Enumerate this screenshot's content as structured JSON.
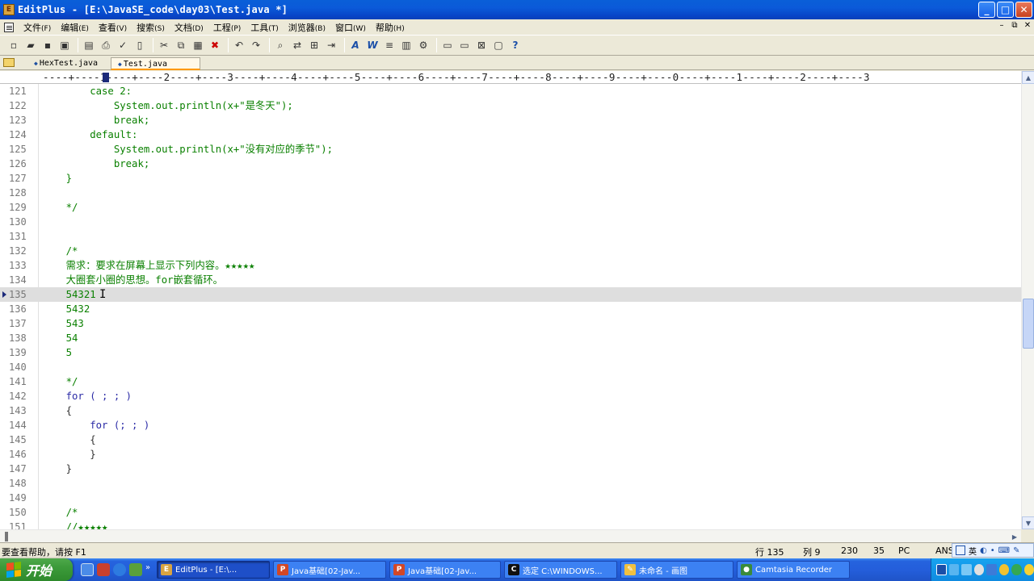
{
  "window": {
    "title": "EditPlus - [E:\\JavaSE_code\\day03\\Test.java *]",
    "minimize": "_",
    "maximize": "□",
    "close": "✕"
  },
  "menu": [
    {
      "label": "文件",
      "acc": "(F)"
    },
    {
      "label": "编辑",
      "acc": "(E)"
    },
    {
      "label": "查看",
      "acc": "(V)"
    },
    {
      "label": "搜索",
      "acc": "(S)"
    },
    {
      "label": "文档",
      "acc": "(D)"
    },
    {
      "label": "工程",
      "acc": "(P)"
    },
    {
      "label": "工具",
      "acc": "(T)"
    },
    {
      "label": "浏览器",
      "acc": "(B)"
    },
    {
      "label": "窗口",
      "acc": "(W)"
    },
    {
      "label": "帮助",
      "acc": "(H)"
    }
  ],
  "mdi_buttons": [
    "–",
    "⧉",
    "✕"
  ],
  "toolbar_icons": [
    "new-file-icon",
    "open-folder-icon",
    "save-icon",
    "save-all-icon",
    "sep",
    "print-preview-icon",
    "print-icon",
    "spell-check-icon",
    "page-icon",
    "sep",
    "cut-icon",
    "copy-icon",
    "paste-icon",
    "delete-icon",
    "sep",
    "undo-icon",
    "redo-icon",
    "sep",
    "find-icon",
    "replace-icon",
    "find-files-icon",
    "goto-icon",
    "sep",
    "font-icon",
    "word-wrap-icon",
    "indent-icon",
    "column-icon",
    "settings-icon",
    "sep",
    "window-icon",
    "window2-icon",
    "close-window-icon",
    "browser-icon",
    "help-icon"
  ],
  "tabs": [
    {
      "label": "HexTest.java",
      "active": false
    },
    {
      "label": "Test.java",
      "active": true
    }
  ],
  "ruler": "----+----1----+----2----+----3----+----4----+----5----+----6----+----7----+----8----+----9----+----0----+----1----+----2----+----3",
  "editor": {
    "lines": [
      {
        "n": "121",
        "text": "        case 2:",
        "style": "comment"
      },
      {
        "n": "122",
        "text": "            System.out.println(x+\"是冬天\");",
        "style": "comment"
      },
      {
        "n": "123",
        "text": "            break;",
        "style": "comment"
      },
      {
        "n": "124",
        "text": "        default:",
        "style": "comment"
      },
      {
        "n": "125",
        "text": "            System.out.println(x+\"没有对应的季节\");",
        "style": "comment"
      },
      {
        "n": "126",
        "text": "            break;",
        "style": "comment"
      },
      {
        "n": "127",
        "text": "    }",
        "style": "comment"
      },
      {
        "n": "128",
        "text": "",
        "style": "comment"
      },
      {
        "n": "129",
        "text": "    */",
        "style": "comment"
      },
      {
        "n": "130",
        "text": "",
        "style": "comment"
      },
      {
        "n": "131",
        "text": "",
        "style": "comment"
      },
      {
        "n": "132",
        "text": "    /*",
        "style": "comment"
      },
      {
        "n": "133",
        "text": "    需求：要求在屏幕上显示下列内容。★★★★★",
        "style": "comment"
      },
      {
        "n": "134",
        "text": "    大圈套小圈的思想。for嵌套循环。",
        "style": "comment"
      },
      {
        "n": "135",
        "text": "    54321",
        "style": "comment",
        "current": true
      },
      {
        "n": "136",
        "text": "    5432",
        "style": "comment"
      },
      {
        "n": "137",
        "text": "    543",
        "style": "comment"
      },
      {
        "n": "138",
        "text": "    54",
        "style": "comment"
      },
      {
        "n": "139",
        "text": "    5",
        "style": "comment"
      },
      {
        "n": "140",
        "text": "",
        "style": "comment"
      },
      {
        "n": "141",
        "text": "    */",
        "style": "comment"
      },
      {
        "n": "142",
        "text": "    for ( ; ; )",
        "style": "kw"
      },
      {
        "n": "143",
        "text": "    {",
        "style": "default"
      },
      {
        "n": "144",
        "text": "        for (; ; )",
        "style": "kw"
      },
      {
        "n": "145",
        "text": "        {",
        "style": "default"
      },
      {
        "n": "146",
        "text": "        }",
        "style": "default"
      },
      {
        "n": "147",
        "text": "    }",
        "style": "default"
      },
      {
        "n": "148",
        "text": "",
        "style": "default"
      },
      {
        "n": "149",
        "text": "",
        "style": "default"
      },
      {
        "n": "150",
        "text": "    /*",
        "style": "comment"
      },
      {
        "n": "151",
        "text": "    //★★★★★",
        "style": "comment"
      }
    ]
  },
  "status": {
    "help": "要查看帮助，请按 F1",
    "row": "行 135",
    "col": "列 9",
    "total": "230",
    "chars": "35",
    "mode": "PC",
    "encoding": "ANS",
    "ime": "英"
  },
  "taskbar": {
    "start": "开始",
    "tasks": [
      {
        "label": "EditPlus - [E:\\...",
        "icon": "editplus",
        "active": true,
        "width": 140
      },
      {
        "label": "Java基础[02-Jav...",
        "icon": "ppt",
        "active": false,
        "width": 140
      },
      {
        "label": "Java基础[02-Jav...",
        "icon": "ppt",
        "active": false,
        "width": 138
      },
      {
        "label": "选定 C:\\WINDOWS...",
        "icon": "cmd",
        "active": false,
        "width": 140
      },
      {
        "label": "未命名 - 画图",
        "icon": "paint",
        "active": false,
        "width": 140
      },
      {
        "label": "Camtasia Recorder",
        "icon": "camtasia",
        "active": false,
        "width": 140
      }
    ]
  }
}
